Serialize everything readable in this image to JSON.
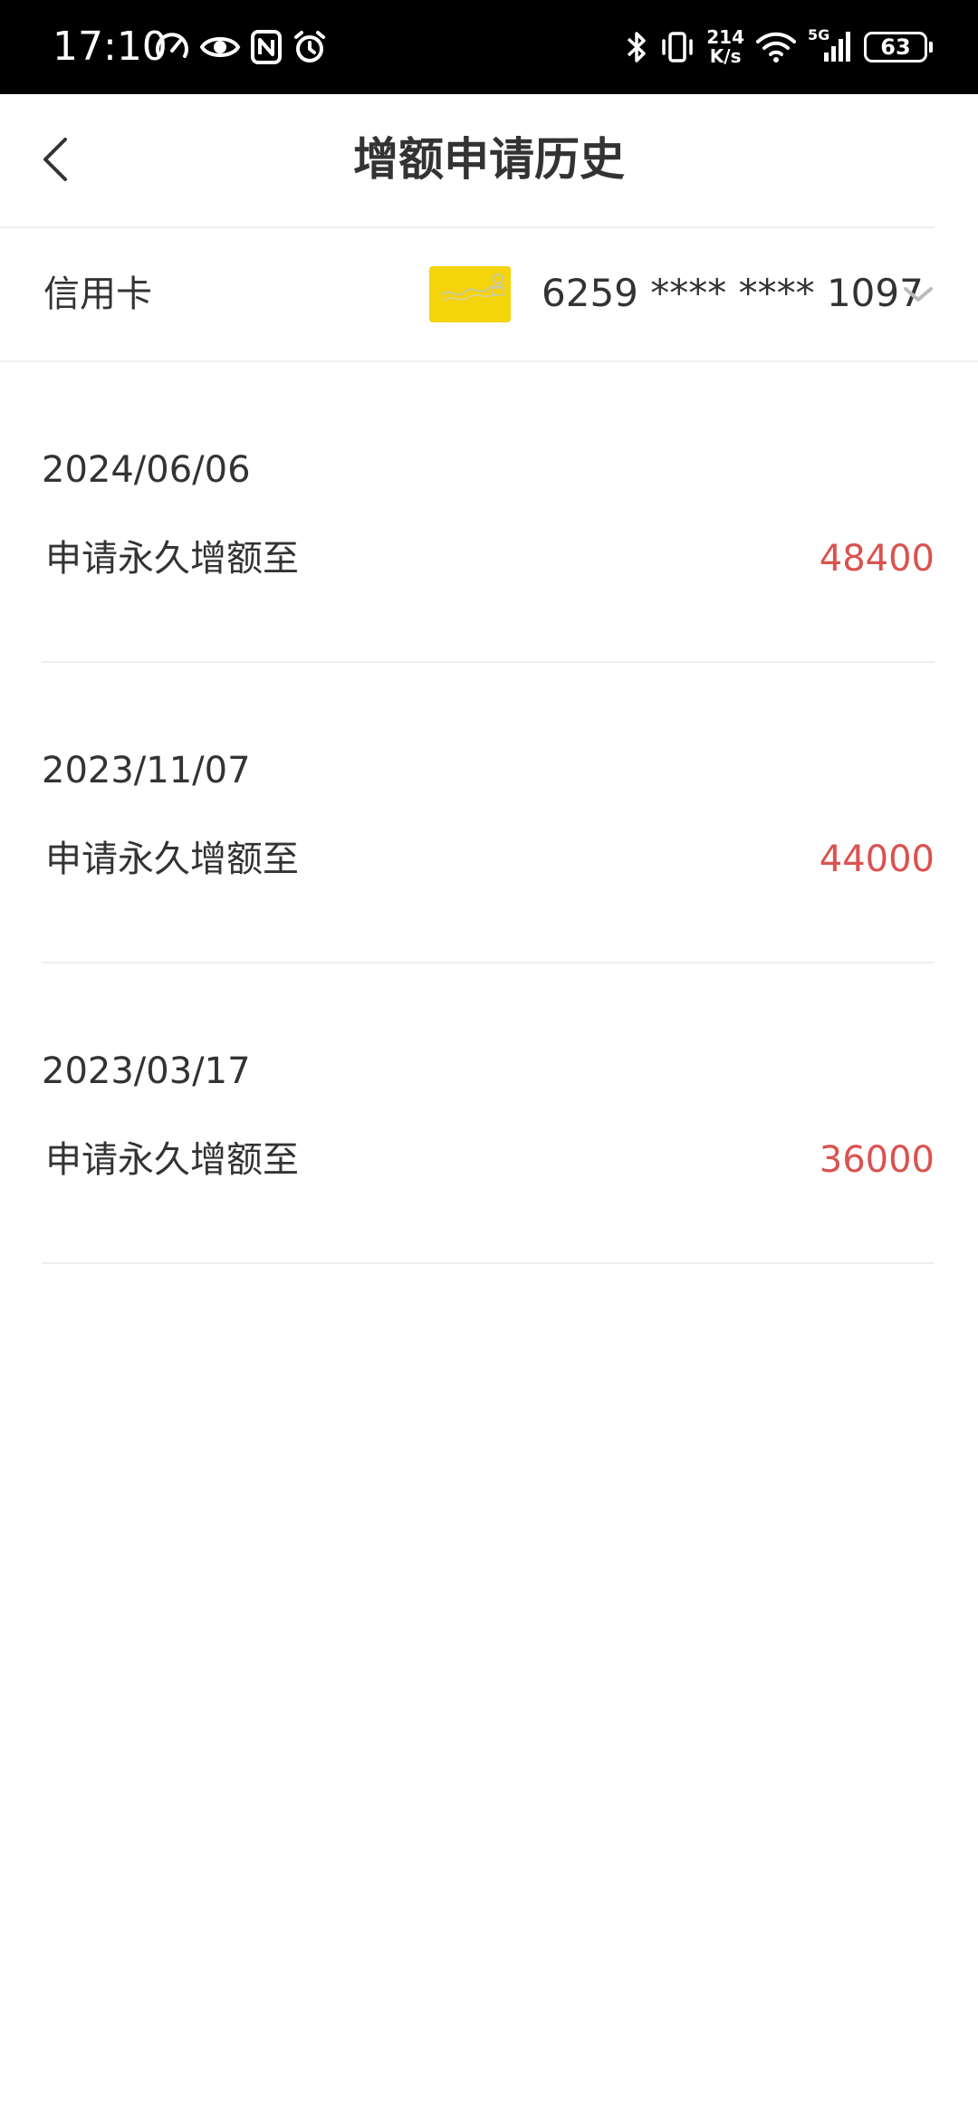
{
  "status_bar": {
    "time": "17:10",
    "net_speed_value": "214",
    "net_speed_unit": "K/s",
    "network_type": "5G",
    "battery_level": "63"
  },
  "header": {
    "title": "增额申请历史"
  },
  "card_selector": {
    "label": "信用卡",
    "card_number": "6259 **** **** 1097",
    "card_color": "#f4d40a"
  },
  "history": [
    {
      "date": "2024/06/06",
      "description": "申请永久增额至",
      "amount": "48400"
    },
    {
      "date": "2023/11/07",
      "description": "申请永久增额至",
      "amount": "44000"
    },
    {
      "date": "2023/03/17",
      "description": "申请永久增额至",
      "amount": "36000"
    }
  ],
  "colors": {
    "amount": "#d9534f",
    "status_bar_bg": "#000000"
  }
}
